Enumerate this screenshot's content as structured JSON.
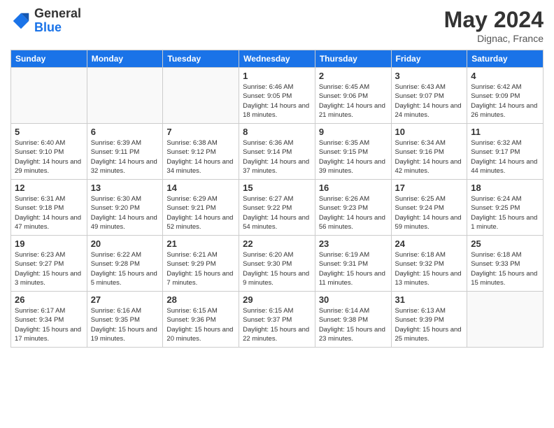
{
  "header": {
    "logo_general": "General",
    "logo_blue": "Blue",
    "month_year": "May 2024",
    "location": "Dignac, France"
  },
  "days_of_week": [
    "Sunday",
    "Monday",
    "Tuesday",
    "Wednesday",
    "Thursday",
    "Friday",
    "Saturday"
  ],
  "weeks": [
    [
      {
        "day": "",
        "info": ""
      },
      {
        "day": "",
        "info": ""
      },
      {
        "day": "",
        "info": ""
      },
      {
        "day": "1",
        "info": "Sunrise: 6:46 AM\nSunset: 9:05 PM\nDaylight: 14 hours and 18 minutes."
      },
      {
        "day": "2",
        "info": "Sunrise: 6:45 AM\nSunset: 9:06 PM\nDaylight: 14 hours and 21 minutes."
      },
      {
        "day": "3",
        "info": "Sunrise: 6:43 AM\nSunset: 9:07 PM\nDaylight: 14 hours and 24 minutes."
      },
      {
        "day": "4",
        "info": "Sunrise: 6:42 AM\nSunset: 9:09 PM\nDaylight: 14 hours and 26 minutes."
      }
    ],
    [
      {
        "day": "5",
        "info": "Sunrise: 6:40 AM\nSunset: 9:10 PM\nDaylight: 14 hours and 29 minutes."
      },
      {
        "day": "6",
        "info": "Sunrise: 6:39 AM\nSunset: 9:11 PM\nDaylight: 14 hours and 32 minutes."
      },
      {
        "day": "7",
        "info": "Sunrise: 6:38 AM\nSunset: 9:12 PM\nDaylight: 14 hours and 34 minutes."
      },
      {
        "day": "8",
        "info": "Sunrise: 6:36 AM\nSunset: 9:14 PM\nDaylight: 14 hours and 37 minutes."
      },
      {
        "day": "9",
        "info": "Sunrise: 6:35 AM\nSunset: 9:15 PM\nDaylight: 14 hours and 39 minutes."
      },
      {
        "day": "10",
        "info": "Sunrise: 6:34 AM\nSunset: 9:16 PM\nDaylight: 14 hours and 42 minutes."
      },
      {
        "day": "11",
        "info": "Sunrise: 6:32 AM\nSunset: 9:17 PM\nDaylight: 14 hours and 44 minutes."
      }
    ],
    [
      {
        "day": "12",
        "info": "Sunrise: 6:31 AM\nSunset: 9:18 PM\nDaylight: 14 hours and 47 minutes."
      },
      {
        "day": "13",
        "info": "Sunrise: 6:30 AM\nSunset: 9:20 PM\nDaylight: 14 hours and 49 minutes."
      },
      {
        "day": "14",
        "info": "Sunrise: 6:29 AM\nSunset: 9:21 PM\nDaylight: 14 hours and 52 minutes."
      },
      {
        "day": "15",
        "info": "Sunrise: 6:27 AM\nSunset: 9:22 PM\nDaylight: 14 hours and 54 minutes."
      },
      {
        "day": "16",
        "info": "Sunrise: 6:26 AM\nSunset: 9:23 PM\nDaylight: 14 hours and 56 minutes."
      },
      {
        "day": "17",
        "info": "Sunrise: 6:25 AM\nSunset: 9:24 PM\nDaylight: 14 hours and 59 minutes."
      },
      {
        "day": "18",
        "info": "Sunrise: 6:24 AM\nSunset: 9:25 PM\nDaylight: 15 hours and 1 minute."
      }
    ],
    [
      {
        "day": "19",
        "info": "Sunrise: 6:23 AM\nSunset: 9:27 PM\nDaylight: 15 hours and 3 minutes."
      },
      {
        "day": "20",
        "info": "Sunrise: 6:22 AM\nSunset: 9:28 PM\nDaylight: 15 hours and 5 minutes."
      },
      {
        "day": "21",
        "info": "Sunrise: 6:21 AM\nSunset: 9:29 PM\nDaylight: 15 hours and 7 minutes."
      },
      {
        "day": "22",
        "info": "Sunrise: 6:20 AM\nSunset: 9:30 PM\nDaylight: 15 hours and 9 minutes."
      },
      {
        "day": "23",
        "info": "Sunrise: 6:19 AM\nSunset: 9:31 PM\nDaylight: 15 hours and 11 minutes."
      },
      {
        "day": "24",
        "info": "Sunrise: 6:18 AM\nSunset: 9:32 PM\nDaylight: 15 hours and 13 minutes."
      },
      {
        "day": "25",
        "info": "Sunrise: 6:18 AM\nSunset: 9:33 PM\nDaylight: 15 hours and 15 minutes."
      }
    ],
    [
      {
        "day": "26",
        "info": "Sunrise: 6:17 AM\nSunset: 9:34 PM\nDaylight: 15 hours and 17 minutes."
      },
      {
        "day": "27",
        "info": "Sunrise: 6:16 AM\nSunset: 9:35 PM\nDaylight: 15 hours and 19 minutes."
      },
      {
        "day": "28",
        "info": "Sunrise: 6:15 AM\nSunset: 9:36 PM\nDaylight: 15 hours and 20 minutes."
      },
      {
        "day": "29",
        "info": "Sunrise: 6:15 AM\nSunset: 9:37 PM\nDaylight: 15 hours and 22 minutes."
      },
      {
        "day": "30",
        "info": "Sunrise: 6:14 AM\nSunset: 9:38 PM\nDaylight: 15 hours and 23 minutes."
      },
      {
        "day": "31",
        "info": "Sunrise: 6:13 AM\nSunset: 9:39 PM\nDaylight: 15 hours and 25 minutes."
      },
      {
        "day": "",
        "info": ""
      }
    ]
  ]
}
